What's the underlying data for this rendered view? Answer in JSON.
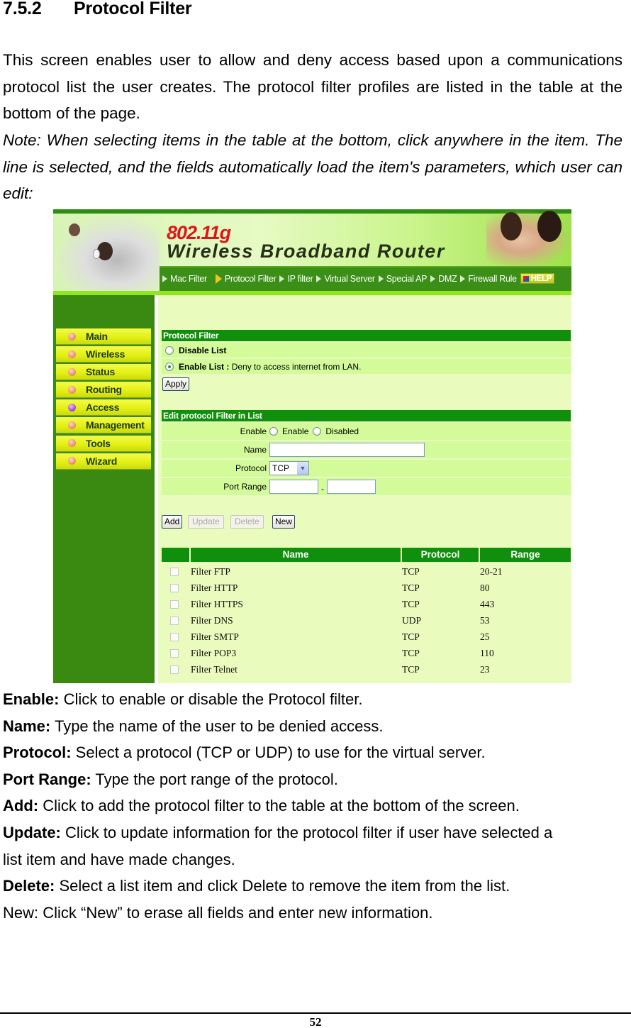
{
  "heading": {
    "number": "7.5.2",
    "title": "Protocol Filter"
  },
  "intro": "This screen enables user to allow and deny access based upon a communications protocol list the user creates. The protocol filter profiles are listed in the table at the bottom of the page.",
  "note": "Note: When selecting items in the table at the bottom, click anywhere in the item. The line is selected, and the fields automatically load the item's parameters, which user can edit:",
  "router_ui": {
    "logo_model": "802.11g",
    "logo_title": "Wireless Broadband Router",
    "nav": [
      {
        "label": "Mac Filter",
        "active": false
      },
      {
        "label": "Protocol Filter",
        "active": true
      },
      {
        "label": "IP filter",
        "active": false
      },
      {
        "label": "Virtual Server",
        "active": false
      },
      {
        "label": "Special AP",
        "active": false
      },
      {
        "label": "DMZ",
        "active": false
      },
      {
        "label": "Firewall Rule",
        "active": false
      }
    ],
    "help_label": "HELP",
    "sidebar": [
      {
        "label": "Main"
      },
      {
        "label": "Wireless"
      },
      {
        "label": "Status"
      },
      {
        "label": "Routing"
      },
      {
        "label": "Access",
        "active": true
      },
      {
        "label": "Management"
      },
      {
        "label": "Tools"
      },
      {
        "label": "Wizard"
      }
    ],
    "protocol_filter": {
      "title": "Protocol Filter",
      "disable_label": "Disable List",
      "enable_label": "Enable List :",
      "enable_desc": "Deny to access internet from LAN.",
      "selected": "enable",
      "apply_label": "Apply"
    },
    "edit": {
      "title": "Edit protocol Filter in List",
      "enable_label": "Enable",
      "enable_opt": "Enable",
      "disabled_opt": "Disabled",
      "name_label": "Name",
      "name_value": "",
      "protocol_label": "Protocol",
      "protocol_value": "TCP",
      "port_range_label": "Port Range",
      "port_from": "",
      "port_sep": "-",
      "port_to": ""
    },
    "buttons": {
      "add": "Add",
      "update": "Update",
      "delete": "Delete",
      "new": "New"
    },
    "table": {
      "headers": [
        "",
        "Name",
        "Protocol",
        "Range"
      ],
      "rows": [
        {
          "name": "Filter FTP",
          "protocol": "TCP",
          "range": "20-21"
        },
        {
          "name": "Filter HTTP",
          "protocol": "TCP",
          "range": "80"
        },
        {
          "name": "Filter HTTPS",
          "protocol": "TCP",
          "range": "443"
        },
        {
          "name": "Filter DNS",
          "protocol": "UDP",
          "range": "53"
        },
        {
          "name": "Filter SMTP",
          "protocol": "TCP",
          "range": "25"
        },
        {
          "name": "Filter POP3",
          "protocol": "TCP",
          "range": "110"
        },
        {
          "name": "Filter Telnet",
          "protocol": "TCP",
          "range": "23"
        }
      ]
    },
    "colors": {
      "header_green": "#108f0c",
      "row_green": "#d3fb9a",
      "sidebar_green": "#3a8910",
      "logo_red": "#e3121a"
    }
  },
  "descriptions": [
    {
      "key": "Enable:",
      "text": " Click to enable or disable the Protocol filter."
    },
    {
      "key": "Name:",
      "text": " Type the name of the user to be denied access."
    },
    {
      "key": "Protocol:",
      "text": " Select a protocol (TCP or UDP) to use for the virtual server."
    },
    {
      "key": "Port Range:",
      "text": " Type the port range of the protocol."
    },
    {
      "key": "Add:",
      "text": " Click to add the protocol filter to the table at the bottom of the screen."
    },
    {
      "key": "Update:",
      "text": " Click to update information for the protocol filter if user have selected a"
    },
    {
      "key": "",
      "text": "list item and have made changes."
    },
    {
      "key": "Delete:",
      "text": " Select a list item and click Delete to remove the item from the list."
    },
    {
      "key": "",
      "text": "New: Click “New” to erase all fields and enter new information."
    }
  ],
  "page_number": "52"
}
